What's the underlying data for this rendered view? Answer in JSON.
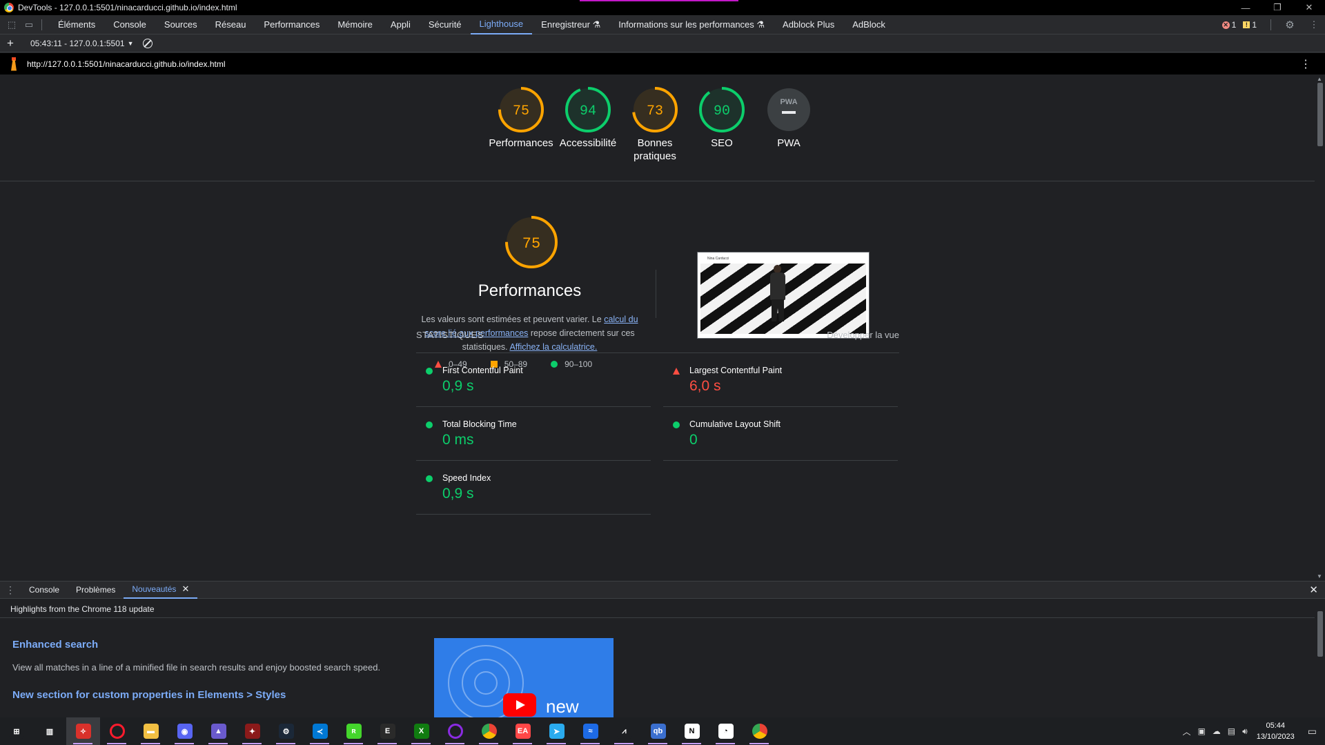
{
  "window": {
    "title": "DevTools - 127.0.0.1:5501/ninacarducci.github.io/index.html",
    "minimize": "—",
    "restore": "❐",
    "close": "✕"
  },
  "devtools": {
    "tabs": [
      "Éléments",
      "Console",
      "Sources",
      "Réseau",
      "Performances",
      "Mémoire",
      "Appli",
      "Sécurité",
      "Lighthouse",
      "Enregistreur ⚗",
      "Informations sur les performances ⚗",
      "Adblock Plus",
      "AdBlock"
    ],
    "active_tab": "Lighthouse",
    "errors_count": "1",
    "warnings_count": "1",
    "report_select": "05:43:11 - 127.0.0.1:5501",
    "url": "http://127.0.0.1:5501/ninacarducci.github.io/index.html"
  },
  "scores": [
    {
      "label": "Performances",
      "value": 75,
      "color": "#ffa400"
    },
    {
      "label": "Accessibilité",
      "value": 94,
      "color": "#0cce6b"
    },
    {
      "label": "Bonnes pratiques",
      "value": 73,
      "color": "#ffa400"
    },
    {
      "label": "SEO",
      "value": 90,
      "color": "#0cce6b"
    },
    {
      "label": "PWA",
      "value": null,
      "badge": "PWA",
      "color": "#9aa0a6"
    }
  ],
  "performance": {
    "score": 75,
    "color": "#ffa400",
    "title": "Performances",
    "desc_1": "Les valeurs sont estimées et peuvent varier. Le ",
    "desc_link1": "calcul du score lié aux performances",
    "desc_2": " repose directement sur ces statistiques. ",
    "desc_link2": "Affichez la calculatrice.",
    "legend": {
      "poor": "0–49",
      "average": "50–89",
      "good": "90–100"
    },
    "screenshot_brand": "Nina Carducci"
  },
  "metrics": {
    "header": "STATISTIQUES",
    "expand": "Développer la vue",
    "items": [
      {
        "name": "First Contentful Paint",
        "value": "0,9 s",
        "status": "good"
      },
      {
        "name": "Largest Contentful Paint",
        "value": "6,0 s",
        "status": "poor"
      },
      {
        "name": "Total Blocking Time",
        "value": "0 ms",
        "status": "good"
      },
      {
        "name": "Cumulative Layout Shift",
        "value": "0",
        "status": "good"
      },
      {
        "name": "Speed Index",
        "value": "0,9 s",
        "status": "good"
      }
    ]
  },
  "drawer": {
    "tabs": [
      "Console",
      "Problèmes",
      "Nouveautés"
    ],
    "active_tab": "Nouveautés",
    "header": "Highlights from the Chrome 118 update",
    "feature1_title": "Enhanced search",
    "feature1_desc": "View all matches in a line of a minified file in search results and enjoy boosted search speed.",
    "feature2_title": "New section for custom properties in Elements > Styles",
    "video_text": "new"
  },
  "taskbar": {
    "time": "05:44",
    "date": "13/10/2023",
    "apps": [
      "start-icon",
      "task-view-icon",
      "lighthouse-app-icon",
      "opera-icon",
      "file-explorer-icon",
      "discord-icon",
      "bing-icon",
      "game-icon",
      "steam-icon",
      "vscode-icon",
      "razer-icon",
      "epic-games-icon",
      "xbox-icon",
      "cortana-icon",
      "chrome-icon",
      "ea-icon",
      "telegram-icon",
      "wave-icon",
      "dev-icon",
      "qbittorrent-icon",
      "notion-icon",
      "clock-app-icon",
      "chrome-icon-2"
    ]
  }
}
